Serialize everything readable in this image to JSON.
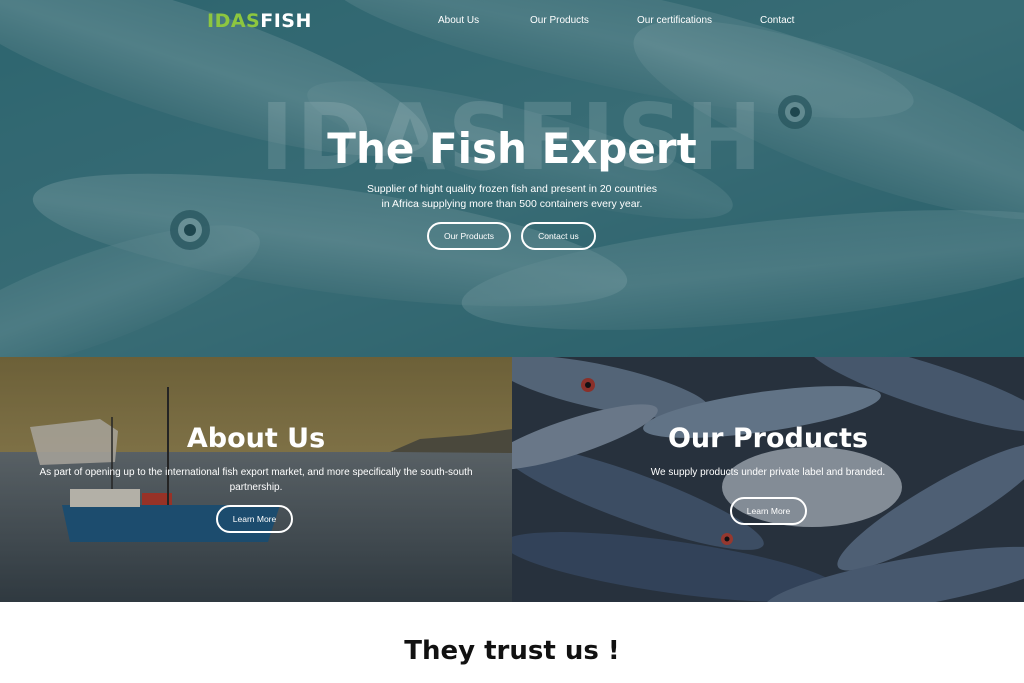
{
  "nav": {
    "logo_part1": "IDAS",
    "logo_part2": "FISH",
    "links": [
      "About Us",
      "Our Products",
      "Our certifications",
      "Contact"
    ]
  },
  "hero": {
    "watermark": "IDASFISH",
    "title": "The Fish Expert",
    "subtitle": "Supplier of hight quality frozen fish and present in 20 countries in Africa supplying more than 500 containers every year.",
    "buttons": [
      "Our Products",
      "Contact us"
    ]
  },
  "about": {
    "title": "About Us",
    "text": "As part of opening up to the international fish export market, and more specifically the south-south partnership.",
    "button": "Learn More"
  },
  "products": {
    "title": "Our Products",
    "text": "We supply products under private label and branded.",
    "button": "Learn More"
  },
  "trust": {
    "title": "They trust us !"
  },
  "colors": {
    "logo_green": "#8dc63f",
    "hero_tint": "#215c68",
    "text_dark": "#111111"
  }
}
